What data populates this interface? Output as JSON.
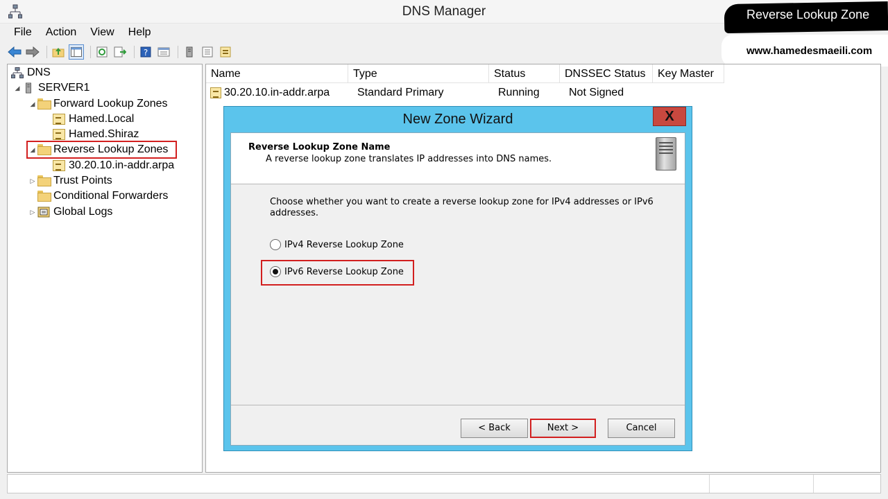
{
  "window": {
    "title": "DNS Manager"
  },
  "menu": [
    "File",
    "Action",
    "View",
    "Help"
  ],
  "toolbar": {
    "icons": [
      "back-arrow-icon",
      "forward-arrow-icon",
      "up-folder-icon",
      "show-hide-tree-icon",
      "refresh-icon",
      "export-list-icon",
      "help-icon",
      "properties-icon",
      "server-icon",
      "list-icon",
      "zone-icon"
    ]
  },
  "tree": {
    "root": "DNS",
    "server": "SERVER1",
    "forward": "Forward Lookup Zones",
    "forward_children": [
      "Hamed.Local",
      "Hamed.Shiraz"
    ],
    "reverse": "Reverse Lookup Zones",
    "reverse_children": [
      "30.20.10.in-addr.arpa"
    ],
    "trust_points": "Trust Points",
    "conditional_forwarders": "Conditional Forwarders",
    "global_logs": "Global Logs"
  },
  "list": {
    "columns": [
      "Name",
      "Type",
      "Status",
      "DNSSEC Status",
      "Key Master"
    ],
    "rows": [
      {
        "name": "30.20.10.in-addr.arpa",
        "type": "Standard Primary",
        "status": "Running",
        "dnssec": "Not Signed",
        "key_master": ""
      }
    ]
  },
  "watermark": {
    "title": "Reverse Lookup Zone",
    "url": "www.hamedesmaeili.com"
  },
  "dialog": {
    "title": "New Zone Wizard",
    "close": "X",
    "header_title": "Reverse Lookup Zone Name",
    "header_subtitle": "A reverse lookup zone translates IP addresses into DNS names.",
    "intro": "Choose whether you want to create a reverse lookup zone for IPv4 addresses or IPv6 addresses.",
    "options": [
      {
        "label": "IPv4 Reverse Lookup Zone",
        "selected": false
      },
      {
        "label": "IPv6 Reverse Lookup Zone",
        "selected": true
      }
    ],
    "buttons": {
      "back": "< Back",
      "next": "Next >",
      "cancel": "Cancel"
    }
  }
}
